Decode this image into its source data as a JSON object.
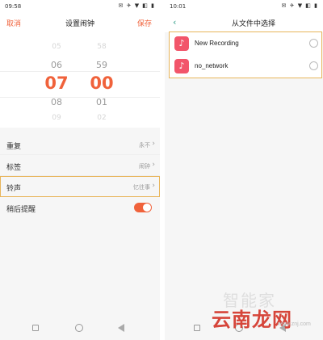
{
  "left_screen": {
    "status": {
      "time": "09:58",
      "icons": "✉ ✈ ▼ ◧ ▮"
    },
    "header": {
      "cancel": "取消",
      "title": "设置闹钟",
      "save": "保存"
    },
    "picker": {
      "hours": [
        "05",
        "06",
        "07",
        "08",
        "09"
      ],
      "minutes": [
        "58",
        "59",
        "00",
        "01",
        "02"
      ],
      "selected_hour": "07",
      "selected_minute": "00"
    },
    "settings": [
      {
        "label": "重复",
        "value": "永不",
        "type": "link"
      },
      {
        "label": "标签",
        "value": "闹钟",
        "type": "link"
      },
      {
        "label": "铃声",
        "value": "忆往事",
        "type": "link",
        "highlighted": true
      },
      {
        "label": "稍后提醒",
        "value": "",
        "type": "toggle",
        "on": true
      }
    ],
    "colors": {
      "accent": "#f0623b",
      "highlight_border": "#e8b55a"
    }
  },
  "right_screen": {
    "status": {
      "time": "10:01",
      "icons": "✉ ✈ ▼ ◧ ▮"
    },
    "header": {
      "back": "‹",
      "title": "从文件中选择"
    },
    "files": [
      {
        "name": "New Recording",
        "icon": "music-note-icon",
        "selected": false
      },
      {
        "name": "no_network",
        "icon": "music-note-icon",
        "selected": false
      }
    ],
    "colors": {
      "back_arrow": "#2f9c86",
      "file_icon_bg": "#f2556a"
    }
  },
  "watermark": {
    "top": "智能家",
    "main": "云南龙网",
    "url": "www.znj.com"
  }
}
